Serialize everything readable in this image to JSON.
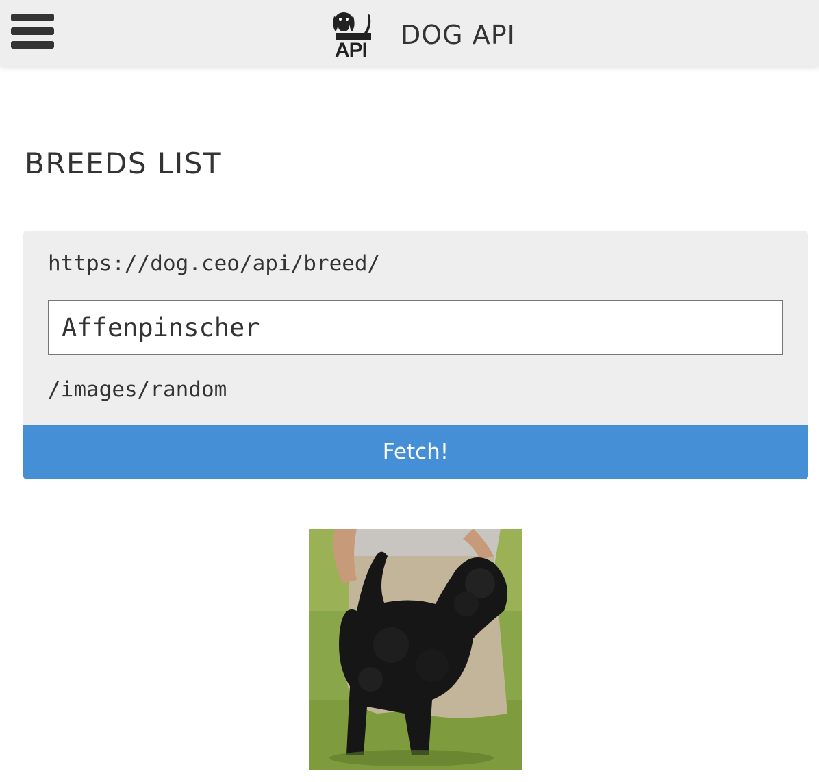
{
  "header": {
    "brand_text": "DOG API",
    "logo_text": "API",
    "menu_icon": "hamburger-menu-icon",
    "logo_icon": "dog-api-logo-icon"
  },
  "main": {
    "title": "BREEDS LIST",
    "endpoint": {
      "prefix": "https://dog.ceo/api/breed/",
      "breed_value": "Affenpinscher",
      "suffix": "/images/random"
    },
    "fetch_label": "Fetch!",
    "result_image": "dog-photo"
  },
  "colors": {
    "topbar_bg": "#eeeeee",
    "panel_bg": "#eeeeee",
    "button_bg": "#458fd6",
    "button_text": "#ffffff",
    "text": "#333333"
  }
}
